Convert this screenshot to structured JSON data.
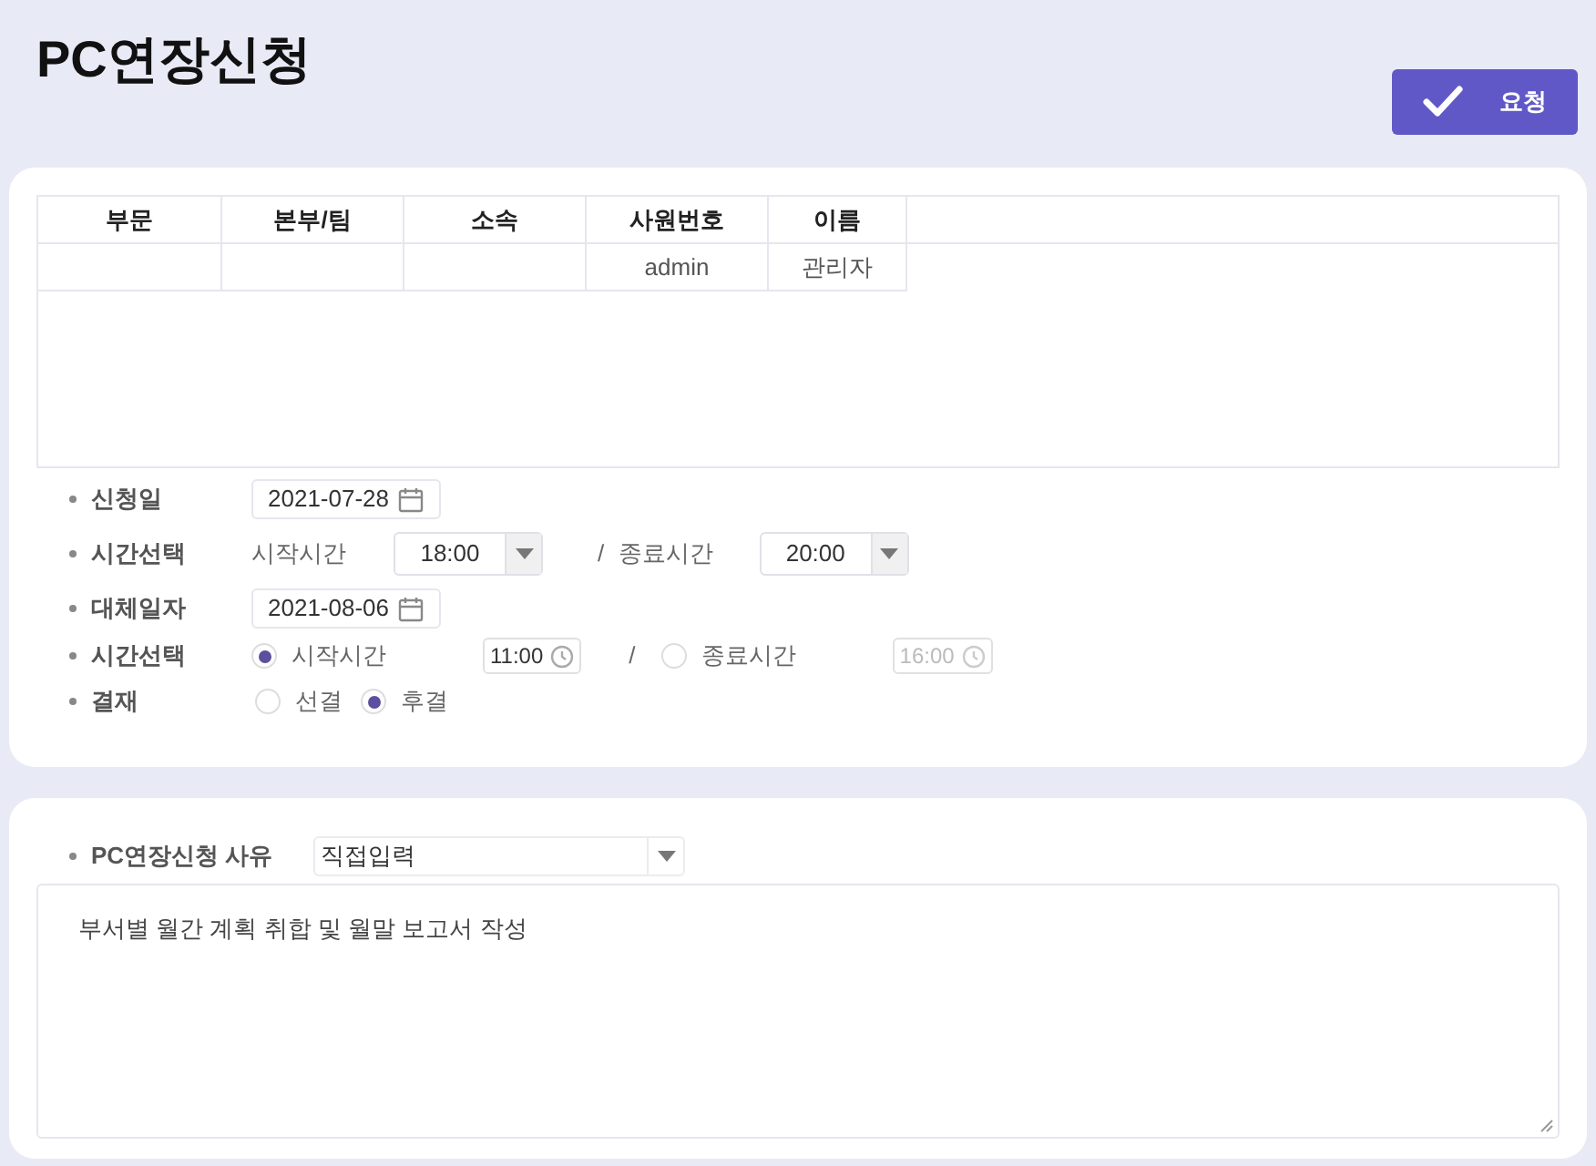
{
  "title": "PC연장신청",
  "submit_button": {
    "label": "요청"
  },
  "table": {
    "columns": [
      "부문",
      "본부/팀",
      "소속",
      "사원번호",
      "이름"
    ],
    "rows": [
      [
        null,
        null,
        null,
        "admin",
        "관리자"
      ]
    ]
  },
  "fields": [
    {
      "kind": "date",
      "label": "신청일",
      "value": "2021-07-28"
    },
    {
      "kind": "time_select",
      "label": "시간선택",
      "start_label": "시작시간",
      "start": "18:00",
      "separator": "/",
      "end_label": "종료시간",
      "end": "20:00"
    },
    {
      "kind": "date",
      "label": "대체일자",
      "value": "2021-08-06"
    },
    {
      "kind": "time_radio",
      "label": "시간선택",
      "separator": "/",
      "options": [
        {
          "label": "시작시간",
          "selected": true,
          "time": "11:00",
          "disabled": false
        },
        {
          "label": "종료시간",
          "selected": false,
          "time": "16:00",
          "disabled": true
        }
      ]
    },
    {
      "kind": "radio",
      "label": "결재",
      "options": [
        {
          "label": "선결",
          "selected": false
        },
        {
          "label": "후결",
          "selected": true
        }
      ]
    }
  ],
  "reason": {
    "label": "PC연장신청 사유",
    "select": "직접입력",
    "text": "부서별 월간 계획 취합 및 월말 보고서 작성"
  }
}
